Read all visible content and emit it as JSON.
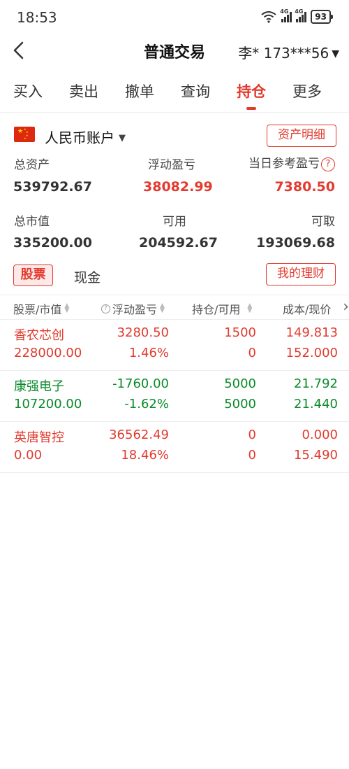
{
  "status": {
    "time": "18:53",
    "battery": "93",
    "net1": "4G",
    "net2": "4G",
    "wifi_tag": "6"
  },
  "nav": {
    "title": "普通交易",
    "account": "李* 173***56"
  },
  "tabs": [
    {
      "label": "买入"
    },
    {
      "label": "卖出"
    },
    {
      "label": "撤单"
    },
    {
      "label": "查询"
    },
    {
      "label": "持仓",
      "active": true
    },
    {
      "label": "更多"
    }
  ],
  "account": {
    "name": "人民币账户",
    "detail_button": "资产明细",
    "total_assets_label": "总资产",
    "total_assets": "539792.67",
    "float_pl_label": "浮动盈亏",
    "float_pl": "38082.99",
    "day_pl_label": "当日参考盈亏",
    "day_pl": "7380.50",
    "market_value_label": "总市值",
    "market_value": "335200.00",
    "available_label": "可用",
    "available": "204592.67",
    "withdrawable_label": "可取",
    "withdrawable": "193069.68"
  },
  "subtabs": {
    "stock": "股票",
    "cash": "现金",
    "finance_button": "我的理财"
  },
  "table": {
    "headers": [
      "股票/市值",
      "浮动盈亏",
      "持仓/可用",
      "成本/现价"
    ],
    "rows": [
      {
        "name": "香农芯创",
        "value": "228000.00",
        "pl": "3280.50",
        "pl_pct": "1.46%",
        "position": "1500",
        "available": "0",
        "cost": "149.813",
        "price": "152.000",
        "trend": "up"
      },
      {
        "name": "康强电子",
        "value": "107200.00",
        "pl": "-1760.00",
        "pl_pct": "-1.62%",
        "position": "5000",
        "available": "5000",
        "cost": "21.792",
        "price": "21.440",
        "trend": "down"
      },
      {
        "name": "英唐智控",
        "value": "0.00",
        "pl": "36562.49",
        "pl_pct": "18.46%",
        "position": "0",
        "available": "0",
        "cost": "0.000",
        "price": "15.490",
        "trend": "up"
      }
    ]
  },
  "colors": {
    "accent": "#e23a2e",
    "loss": "#0a8a2a"
  }
}
